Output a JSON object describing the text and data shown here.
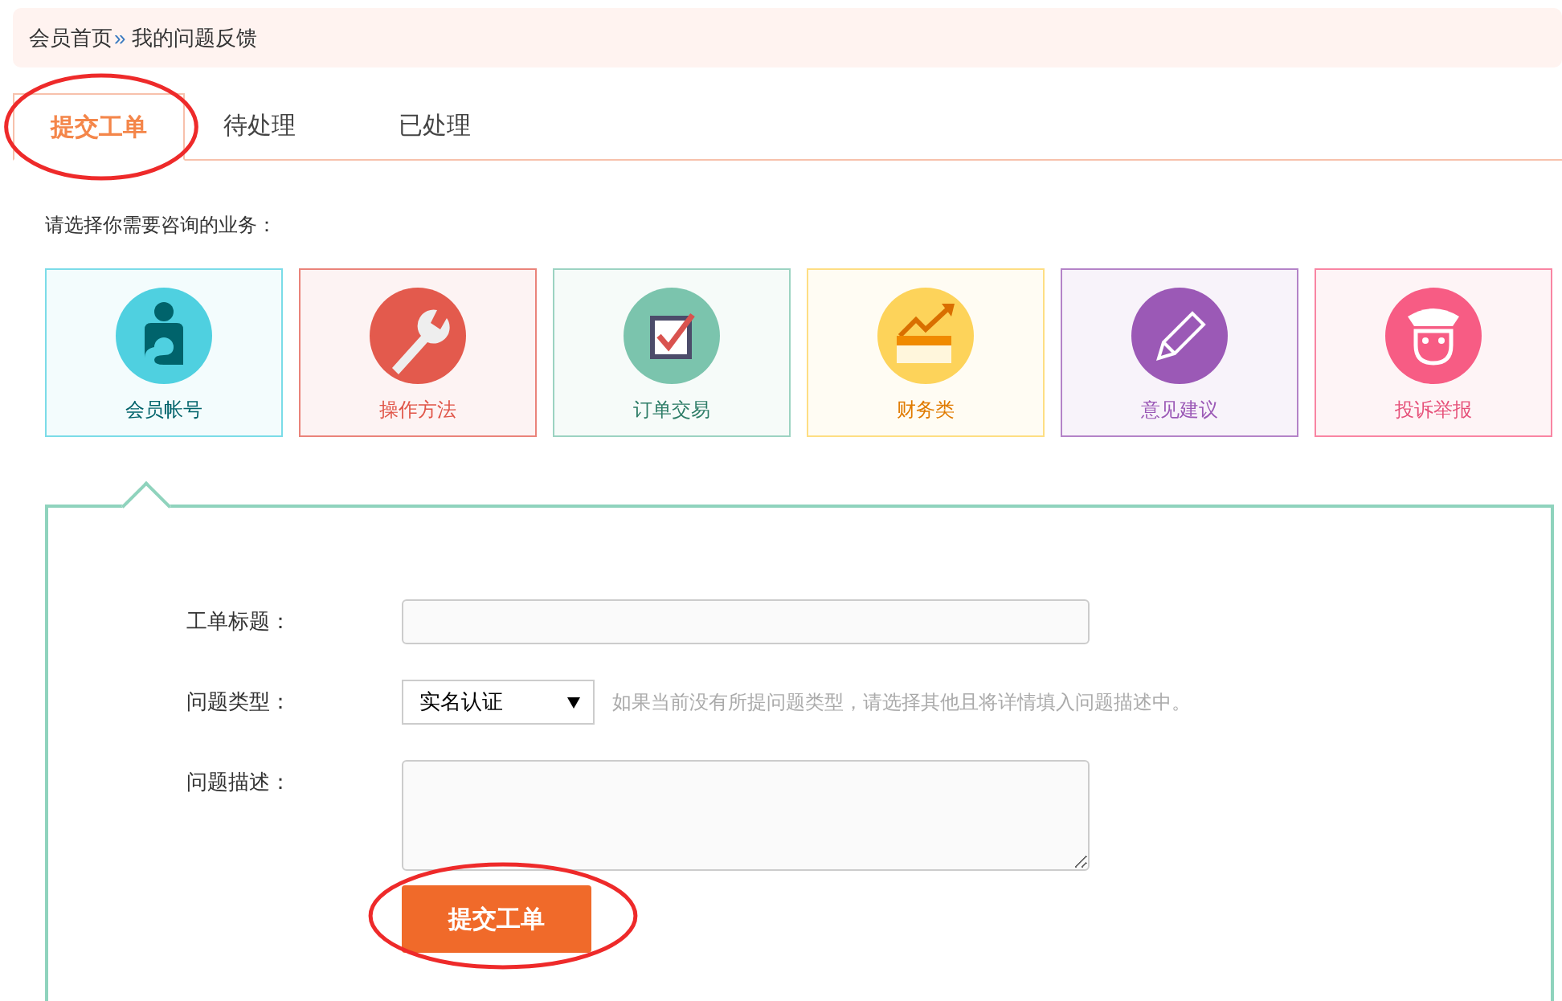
{
  "breadcrumb": {
    "items": [
      "会员首页",
      "我的问题反馈"
    ],
    "separator": "»"
  },
  "tabs": [
    {
      "label": "提交工单",
      "selected": true,
      "circled": true
    },
    {
      "label": "待处理",
      "selected": false,
      "circled": false
    },
    {
      "label": "已处理",
      "selected": false,
      "circled": false
    }
  ],
  "prompt": "请选择你需要咨询的业务：",
  "categories": [
    {
      "label": "会员帐号",
      "kind": "account",
      "color": "#00636b"
    },
    {
      "label": "操作方法",
      "kind": "tool",
      "color": "#e05548"
    },
    {
      "label": "订单交易",
      "kind": "order",
      "color": "#2c7c66"
    },
    {
      "label": "财务类",
      "kind": "finance",
      "color": "#e07b00"
    },
    {
      "label": "意见建议",
      "kind": "suggestion",
      "color": "#9b59b6"
    },
    {
      "label": "投诉举报",
      "kind": "complaint",
      "color": "#e6517a"
    }
  ],
  "form": {
    "fields": [
      {
        "label": "工单标题：",
        "kind": "text"
      },
      {
        "label": "问题类型：",
        "kind": "select",
        "value": "实名认证",
        "hint": "如果当前没有所提问题类型，请选择其他且将详情填入问题描述中。"
      },
      {
        "label": "问题描述：",
        "kind": "textarea"
      }
    ],
    "submit": {
      "label": "提交工单",
      "circled": true
    }
  }
}
